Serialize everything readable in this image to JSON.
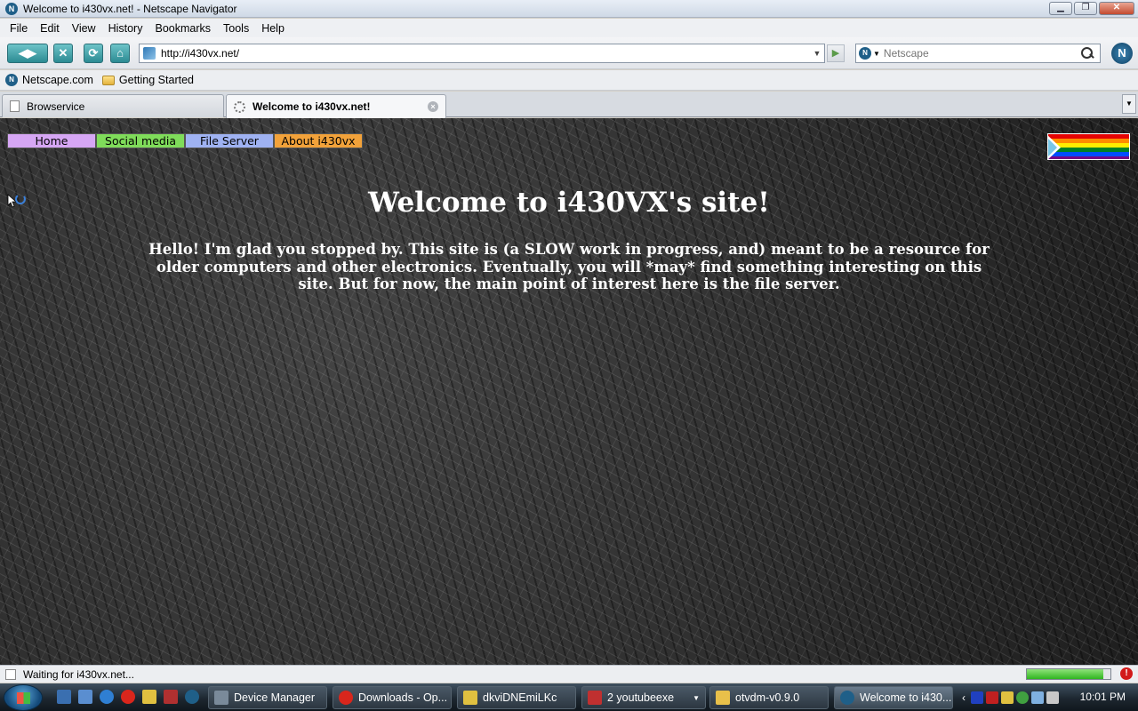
{
  "window": {
    "title": "Welcome to i430vx.net! - Netscape Navigator",
    "app_icon_letter": "N",
    "minimize": "▁",
    "maximize": "❐",
    "close": "✕"
  },
  "menu": [
    "File",
    "Edit",
    "View",
    "History",
    "Bookmarks",
    "Tools",
    "Help"
  ],
  "toolbar": {
    "back_label": "◀▶",
    "stop_label": "✕",
    "reload_label": "⟳",
    "home_label": "⌂",
    "url": "http://i430vx.net/",
    "go_label": "▶",
    "search_placeholder": "Netscape",
    "search_engine_letter": "N",
    "logo_letter": "N"
  },
  "bookmarks": [
    {
      "label": "Netscape.com",
      "icon": "netscape-icon"
    },
    {
      "label": "Getting Started",
      "icon": "folder-icon"
    }
  ],
  "tabs": [
    {
      "label": "Browservice",
      "active": false
    },
    {
      "label": "Welcome to i430vx.net!",
      "active": true,
      "loading": true
    }
  ],
  "tab_close": "×",
  "page": {
    "nav": [
      {
        "label": "Home",
        "color": "#d6a6f4"
      },
      {
        "label": "Social media",
        "color": "#7fdc5a"
      },
      {
        "label": "File Server",
        "color": "#9fb2f2"
      },
      {
        "label": "About i430vx",
        "color": "#f2a23a"
      }
    ],
    "flag_stripes": [
      "#e40303",
      "#ff8c00",
      "#ffed00",
      "#008026",
      "#004dff",
      "#750787"
    ],
    "heading": "Welcome to i430VX's site!",
    "intro": "Hello! I'm glad you stopped by. This site is (a SLOW work in progress, and) meant to be a resource for older computers and other electronics. Eventually, you will *may* find something interesting on this site. But for now, the main point of interest here is the file server."
  },
  "status": {
    "text": "Waiting for i430vx.net...",
    "progress": 0.92,
    "alert": "!"
  },
  "taskbar": {
    "tasks": [
      {
        "label": "Device Manager",
        "icon_color": "#7a8a9a",
        "active": false
      },
      {
        "label": "Downloads - Op...",
        "icon_color": "#d9261c",
        "active": false
      },
      {
        "label": "dkviDNEmiLKc",
        "icon_color": "#e0c040",
        "active": false
      },
      {
        "label": "2 youtubeexe",
        "icon_color": "#c03030",
        "active": false,
        "has_dropdown": true
      },
      {
        "label": "otvdm-v0.9.0",
        "icon_color": "#e8c04a",
        "active": false
      },
      {
        "label": "Welcome to i430...",
        "icon_color": "#1f5f88",
        "active": true
      }
    ],
    "clock": "10:01 PM",
    "tray_chevron": "‹"
  }
}
